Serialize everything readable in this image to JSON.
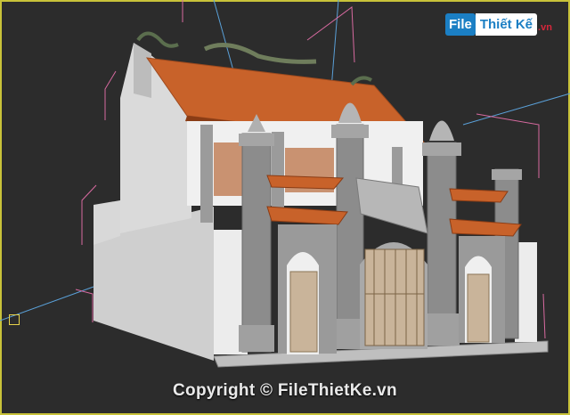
{
  "logo": {
    "box_text": "File",
    "rest_text": "Thiết Kế",
    "domain_text": ".vn"
  },
  "watermark": {
    "text": "Copyright © FileThietKe.vn"
  },
  "colors": {
    "viewport_bg": "#2c2c2c",
    "frame": "#c8c23a",
    "roof": "#c8622a",
    "wall": "#e6e6e6",
    "stone": "#9a9a9a",
    "gate": "#c9b49a",
    "logo_blue": "#1b7fc4",
    "logo_red": "#d6273b"
  },
  "icons": {
    "axis_gizmo": "axis-gizmo-icon"
  }
}
